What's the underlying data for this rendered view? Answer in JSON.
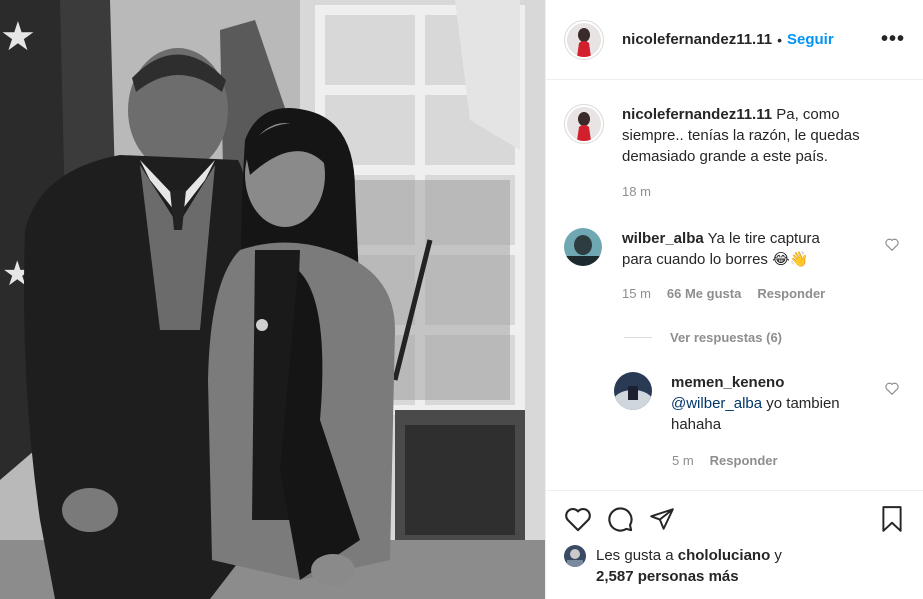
{
  "post": {
    "username": "nicolefernandez11.11",
    "follow_label": "Seguir",
    "dot": "•",
    "more_label": "•••"
  },
  "caption": {
    "username": "nicolefernandez11.11",
    "text": "Pa, como siempre.. tenías la razón, le quedas demasiado grande a este país.",
    "time": "18 m"
  },
  "comments": [
    {
      "username": "wilber_alba",
      "text": "Ya le tire captura para cuando lo borres 😂👋",
      "time": "15 m",
      "likes": "66 Me gusta",
      "reply_label": "Responder"
    }
  ],
  "view_replies": "Ver respuestas (6)",
  "reply": {
    "username": "memen_keneno",
    "mention": "@wilber_alba",
    "text": " yo tambien hahaha",
    "time": "5 m",
    "reply_label": "Responder"
  },
  "likes": {
    "prefix": "Les gusta a ",
    "user": "chololuciano",
    "suffix": " y",
    "count": "2,587 personas más"
  },
  "icons": [
    "more-icon",
    "heart-icon",
    "comment-icon",
    "share-icon",
    "bookmark-icon"
  ],
  "colors": {
    "link": "#0095f6",
    "muted": "#8e8e8e",
    "text": "#262626",
    "mention": "#00376b"
  }
}
